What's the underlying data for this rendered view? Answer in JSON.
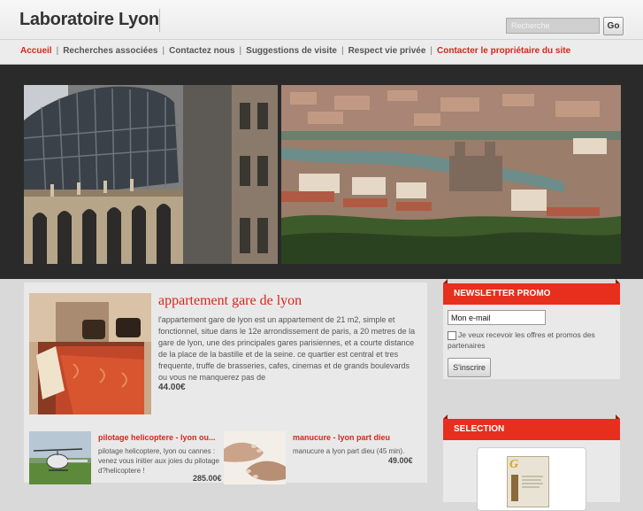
{
  "site": {
    "title": "Laboratoire Lyon"
  },
  "search": {
    "placeholder": "Recherche",
    "button_label": "Go"
  },
  "nav": {
    "items": [
      {
        "label": "Accueil"
      },
      {
        "label": "Recherches associées"
      },
      {
        "label": "Contactez nous"
      },
      {
        "label": "Suggestions de visite"
      },
      {
        "label": "Respect vie privée"
      },
      {
        "label": "Contacter le propriétaire du site"
      }
    ],
    "separator": "|",
    "active_color": "#d7261b"
  },
  "featured": {
    "title": "appartement gare de lyon",
    "description": "l'appartement gare de lyon est un appartement de 21 m2, simple et fonctionnel, situe dans le 12e arrondissement de paris, a 20 metres de la gare de lyon, une des principales gares parisiennes, et a courte distance de la place de la bastille et de la seine. ce quartier est central et tres frequente, truffe de brasseries, cafes, cinemas et de grands boulevards ou vous ne manquerez pas de",
    "price": "44.00€"
  },
  "products": [
    {
      "title": "pilotage helicoptere - lyon ou...",
      "description": "pilotage helicoptere, lyon ou cannes : venez vous initier aux joies du pilotage d?helicoptere !",
      "price": "285.00€"
    },
    {
      "title": "manucure - lyon part dieu",
      "description": "manucure a lyon part dieu (45 min).",
      "price": "49.00€"
    }
  ],
  "newsletter": {
    "title": "NEWSLETTER PROMO",
    "email_value": "Mon e-mail",
    "optin_label": "Je veux recevoir les offres et promos des partenaires",
    "subscribe_label": "S'inscrire"
  },
  "selection": {
    "title": "SELECTION",
    "book_logo": "G"
  },
  "colors": {
    "accent": "#e62f1d",
    "link": "#d7261b",
    "banner_bg": "#2a2a2a",
    "page_bg": "#d9d9d9"
  },
  "icons": {
    "checkbox": "checkbox-icon"
  }
}
